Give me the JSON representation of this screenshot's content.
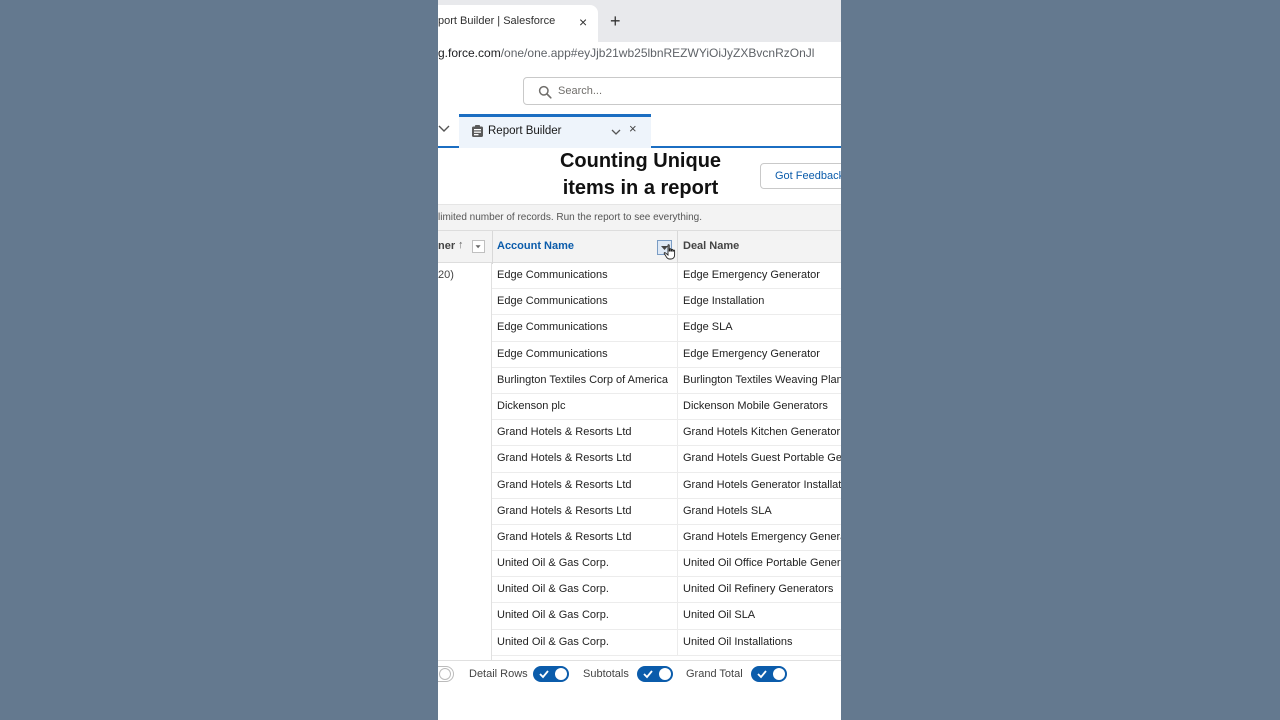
{
  "browser": {
    "tab_title": "port Builder | Salesforce",
    "close_symbol": "×",
    "new_tab_symbol": "+",
    "url_host": "g.force.com",
    "url_path": "/one/one.app#eyJjb21wb25lbnREZWYiOiJyZXBvcnRzOnJl"
  },
  "header": {
    "search_placeholder": "Search..."
  },
  "nav": {
    "active_tab": "Report Builder",
    "close_symbol": "×"
  },
  "overlay": {
    "line1": "Counting Unique",
    "line2": "items in a report"
  },
  "feedback_button": "Got Feedback?",
  "preview_text": "limited number of records. Run the report to see everything.",
  "table": {
    "columns": {
      "owner": "ner",
      "owner_sort": "↑",
      "account": "Account Name",
      "deal": "Deal Name"
    },
    "group_count": "20)",
    "rows": [
      {
        "account": "Edge Communications",
        "deal": "Edge Emergency Generator"
      },
      {
        "account": "Edge Communications",
        "deal": "Edge Installation"
      },
      {
        "account": "Edge Communications",
        "deal": "Edge SLA"
      },
      {
        "account": "Edge Communications",
        "deal": "Edge Emergency Generator"
      },
      {
        "account": "Burlington Textiles Corp of America",
        "deal": "Burlington Textiles Weaving Plant"
      },
      {
        "account": "Dickenson plc",
        "deal": "Dickenson Mobile Generators"
      },
      {
        "account": "Grand Hotels & Resorts Ltd",
        "deal": "Grand Hotels Kitchen Generator"
      },
      {
        "account": "Grand Hotels & Resorts Ltd",
        "deal": "Grand Hotels Guest Portable Generators"
      },
      {
        "account": "Grand Hotels & Resorts Ltd",
        "deal": "Grand Hotels Generator Installations"
      },
      {
        "account": "Grand Hotels & Resorts Ltd",
        "deal": "Grand Hotels SLA"
      },
      {
        "account": "Grand Hotels & Resorts Ltd",
        "deal": "Grand Hotels Emergency Generators"
      },
      {
        "account": "United Oil & Gas Corp.",
        "deal": "United Oil Office Portable Generators"
      },
      {
        "account": "United Oil & Gas Corp.",
        "deal": "United Oil Refinery Generators"
      },
      {
        "account": "United Oil & Gas Corp.",
        "deal": "United Oil SLA"
      },
      {
        "account": "United Oil & Gas Corp.",
        "deal": "United Oil Installations"
      }
    ]
  },
  "footer": {
    "detail_rows": "Detail Rows",
    "subtotals": "Subtotals",
    "grand_total": "Grand Total"
  },
  "colors": {
    "accent": "#0b5cab",
    "backdrop": "#64798f"
  }
}
